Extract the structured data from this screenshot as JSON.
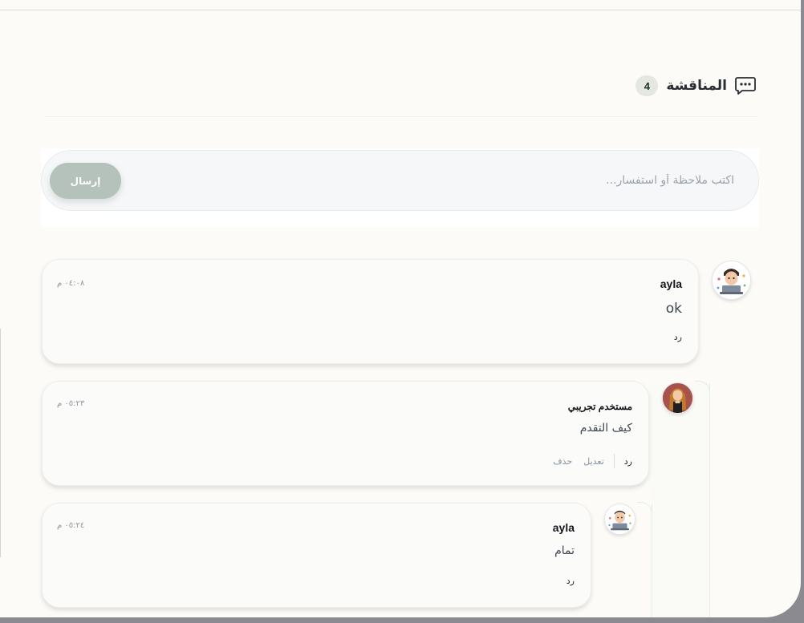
{
  "discussion": {
    "title": "المناقشة",
    "count": "4",
    "icon": "chat-bubble-icon"
  },
  "composer": {
    "placeholder": "اكتب ملاحظة أو استفسار...",
    "send_label": "إرسال"
  },
  "comments": [
    {
      "author": "ayla",
      "text": "ok",
      "time": "٠٤:٠٨ م",
      "reply_label": "رد"
    },
    {
      "author": "مستخدم تجريبي",
      "text": "كيف التقدم",
      "time": "٠٥:٢٣ م",
      "reply_label": "رد",
      "edit_label": "تعديل",
      "delete_label": "حذف"
    },
    {
      "author": "ayla",
      "text": "تمام",
      "time": "٠٥:٢٤ م",
      "reply_label": "رد"
    }
  ],
  "colors": {
    "accent_badge": "#e4e8e1",
    "send_button": "#b4c2bb",
    "page_bg": "#fcfbf7"
  }
}
